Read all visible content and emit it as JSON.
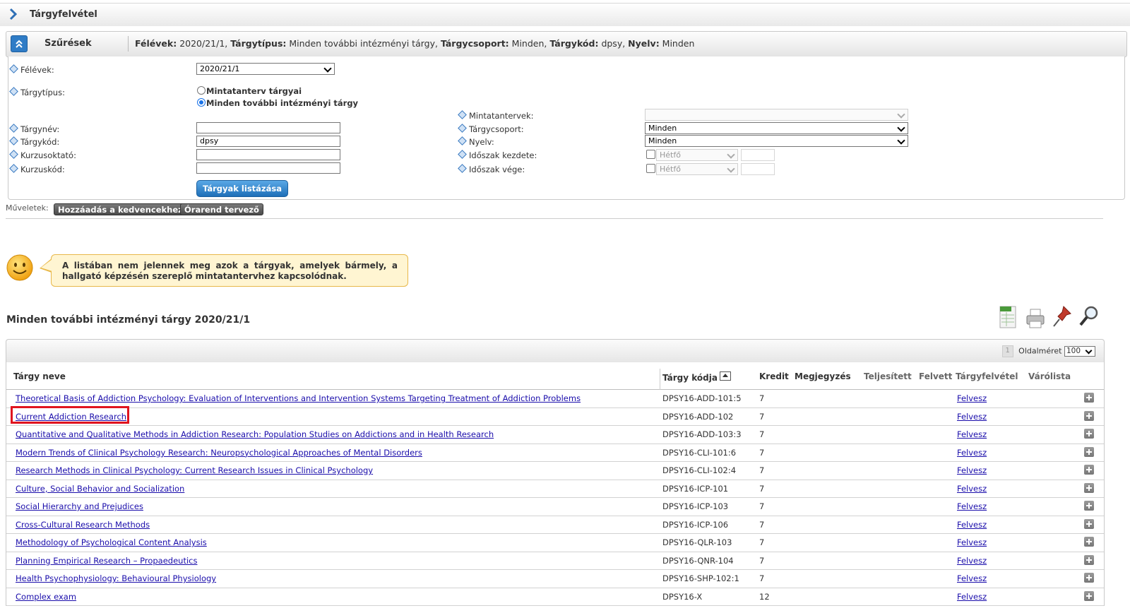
{
  "page": {
    "title": "Tárgyfelvétel"
  },
  "filter_header": {
    "label": "Szűrések",
    "summary": [
      {
        "key": "Félévek:",
        "value": " 2020/21/1, "
      },
      {
        "key": "Tárgytípus:",
        "value": " Minden további intézményi tárgy, "
      },
      {
        "key": "Tárgycsoport:",
        "value": " Minden, "
      },
      {
        "key": "Tárgykód:",
        "value": " dpsy, "
      },
      {
        "key": "Nyelv:",
        "value": " Minden"
      }
    ]
  },
  "filters": {
    "felevek_label": "Félévek:",
    "felevek_value": "2020/21/1",
    "targytipus_label": "Tárgytípus:",
    "radio_mintatanterv": "Mintatanterv tárgyai",
    "radio_minden": "Minden további intézményi tárgy",
    "targynev_label": "Tárgynév:",
    "targynev_value": "",
    "targykod_label": "Tárgykód:",
    "targykod_value": "dpsy",
    "kurzusoktato_label": "Kurzusoktató:",
    "kurzusoktato_value": "",
    "kurzuskod_label": "Kurzuskód:",
    "kurzuskod_value": "",
    "mintatantervek_label": "Mintatantervek:",
    "mintatantervek_value": "",
    "targycsoport_label": "Tárgycsoport:",
    "targycsoport_value": "Minden",
    "nyelv_label": "Nyelv:",
    "nyelv_value": "Minden",
    "idoszak_kezdete_label": "Időszak kezdete:",
    "idoszak_vege_label": "Időszak vége:",
    "day_placeholder": "Hétfő",
    "list_button": "Tárgyak listázása"
  },
  "operations": {
    "label": "Műveletek:",
    "add_favorites": "Hozzáadás a kedvencekhez",
    "timetable_planner": "Órarend tervező"
  },
  "notice": "A listában nem jelennek meg azok a tárgyak, amelyek bármely, a hallgató képzésén szereplő mintatantervhez kapcsolódnak.",
  "section_title": "Minden további intézményi tárgy 2020/21/1",
  "pager": {
    "page": "1",
    "page_size_label": "Oldalméret",
    "page_size": "100"
  },
  "table": {
    "columns": [
      "Tárgy neve",
      "Tárgy kódja",
      "Kredit",
      "Megjegyzés",
      "Teljesített",
      "Felvett",
      "Tárgyfelvétel",
      "Várólista"
    ],
    "rows": [
      {
        "name": "Theoretical Basis of Addiction Psychology: Evaluation of Interventions and Intervention Systems Targeting Treatment of Addiction Problems",
        "code": "DPSY16-ADD-101:5",
        "credit": "7",
        "action": "Felvesz"
      },
      {
        "name": "Current Addiction Research",
        "code": "DPSY16-ADD-102",
        "credit": "7",
        "action": "Felvesz"
      },
      {
        "name": "Quantitative and Qualitative Methods in Addiction Research: Population Studies on Addictions and in Health Research",
        "code": "DPSY16-ADD-103:3",
        "credit": "7",
        "action": "Felvesz"
      },
      {
        "name": "Modern Trends of Clinical Psychology Research: Neuropsychological Approaches of Mental Disorders",
        "code": "DPSY16-CLI-101:6",
        "credit": "7",
        "action": "Felvesz"
      },
      {
        "name": "Research Methods in Clinical Psychology: Current Research Issues in Clinical Psychology",
        "code": "DPSY16-CLI-102:4",
        "credit": "7",
        "action": "Felvesz"
      },
      {
        "name": "Culture, Social Behavior and Socialization",
        "code": "DPSY16-ICP-101",
        "credit": "7",
        "action": "Felvesz"
      },
      {
        "name": "Social Hierarchy and Prejudices",
        "code": "DPSY16-ICP-103",
        "credit": "7",
        "action": "Felvesz"
      },
      {
        "name": "Cross-Cultural Research Methods",
        "code": "DPSY16-ICP-106",
        "credit": "7",
        "action": "Felvesz"
      },
      {
        "name": "Methodology of Psychological Content Analysis",
        "code": "DPSY16-QLR-103",
        "credit": "7",
        "action": "Felvesz"
      },
      {
        "name": "Planning Empirical Research – Propaedeutics",
        "code": "DPSY16-QNR-104",
        "credit": "7",
        "action": "Felvesz"
      },
      {
        "name": "Health Psychophysiology: Behavioural Physiology",
        "code": "DPSY16-SHP-102:1",
        "credit": "7",
        "action": "Felvesz"
      },
      {
        "name": "Complex exam",
        "code": "DPSY16-X",
        "credit": "12",
        "action": "Felvesz"
      }
    ]
  },
  "colors": {
    "link": "#1a0dab",
    "accent_blue": "#2f7cc6",
    "highlight": "#e0141e",
    "notice_bg": "#fff5d2"
  }
}
